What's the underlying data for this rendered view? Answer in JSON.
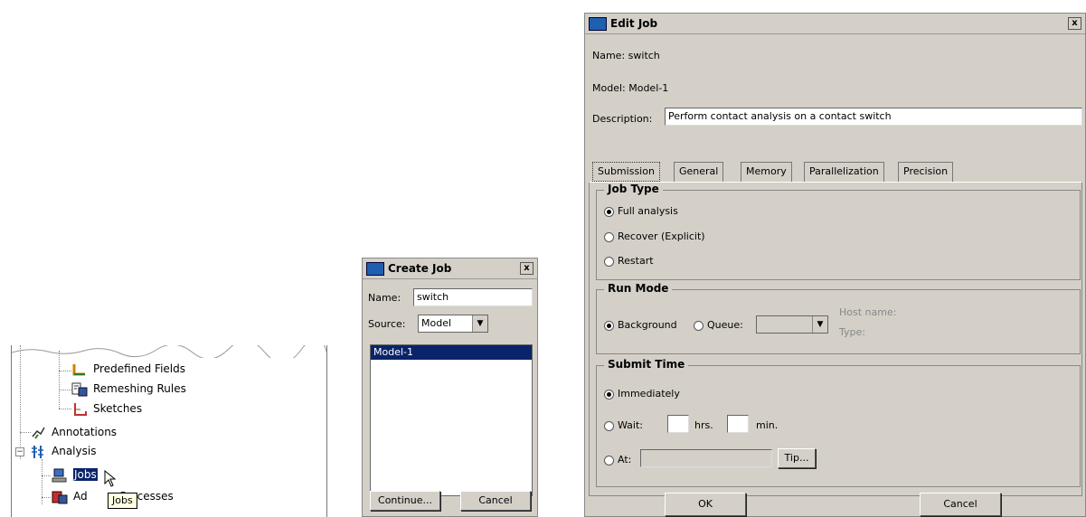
{
  "tree": {
    "items": [
      {
        "label": "Predefined Fields",
        "icon": "predefined-fields-icon"
      },
      {
        "label": "Remeshing Rules",
        "icon": "remeshing-rules-icon"
      },
      {
        "label": "Sketches",
        "icon": "sketches-icon"
      },
      {
        "label": "Annotations",
        "icon": "annotations-icon"
      },
      {
        "label": "Analysis",
        "icon": "analysis-icon"
      },
      {
        "label": "Jobs",
        "icon": "jobs-icon"
      },
      {
        "label": "Adaptivity Processes",
        "icon": "adaptivity-processes-icon"
      }
    ],
    "adaptivity_visible": "Ad",
    "adaptivity_tail": "Processes",
    "tooltip": "Jobs",
    "expand_symbol": "−"
  },
  "create_job": {
    "title": "Create Job",
    "close": "x",
    "name_label": "Name:",
    "name_value": "switch",
    "source_label": "Source:",
    "source_value": "Model",
    "models": [
      "Model-1"
    ],
    "continue_label": "Continue...",
    "cancel_label": "Cancel"
  },
  "edit_job": {
    "title": "Edit Job",
    "close": "x",
    "name_line": "Name:  switch",
    "model_line": "Model:  Model-1",
    "description_label": "Description:",
    "description_value": "Perform contact analysis on a contact switch",
    "tabs": [
      "Submission",
      "General",
      "Memory",
      "Parallelization",
      "Precision"
    ],
    "active_tab": "Submission",
    "job_type": {
      "title": "Job Type",
      "options": [
        "Full analysis",
        "Recover (Explicit)",
        "Restart"
      ],
      "selected": "Full analysis"
    },
    "run_mode": {
      "title": "Run Mode",
      "background": "Background",
      "queue": "Queue:",
      "host_name": "Host name:",
      "type": "Type:",
      "selected": "Background"
    },
    "submit_time": {
      "title": "Submit Time",
      "immediately": "Immediately",
      "wait": "Wait:",
      "hrs": "hrs.",
      "min": "min.",
      "at": "At:",
      "tip": "Tip...",
      "selected": "Immediately"
    },
    "ok_label": "OK",
    "cancel_label": "Cancel"
  },
  "colors": {
    "selection": "#0a246a",
    "dialog_bg": "#d4d0c8",
    "title_icon": "#1f5fb0"
  }
}
